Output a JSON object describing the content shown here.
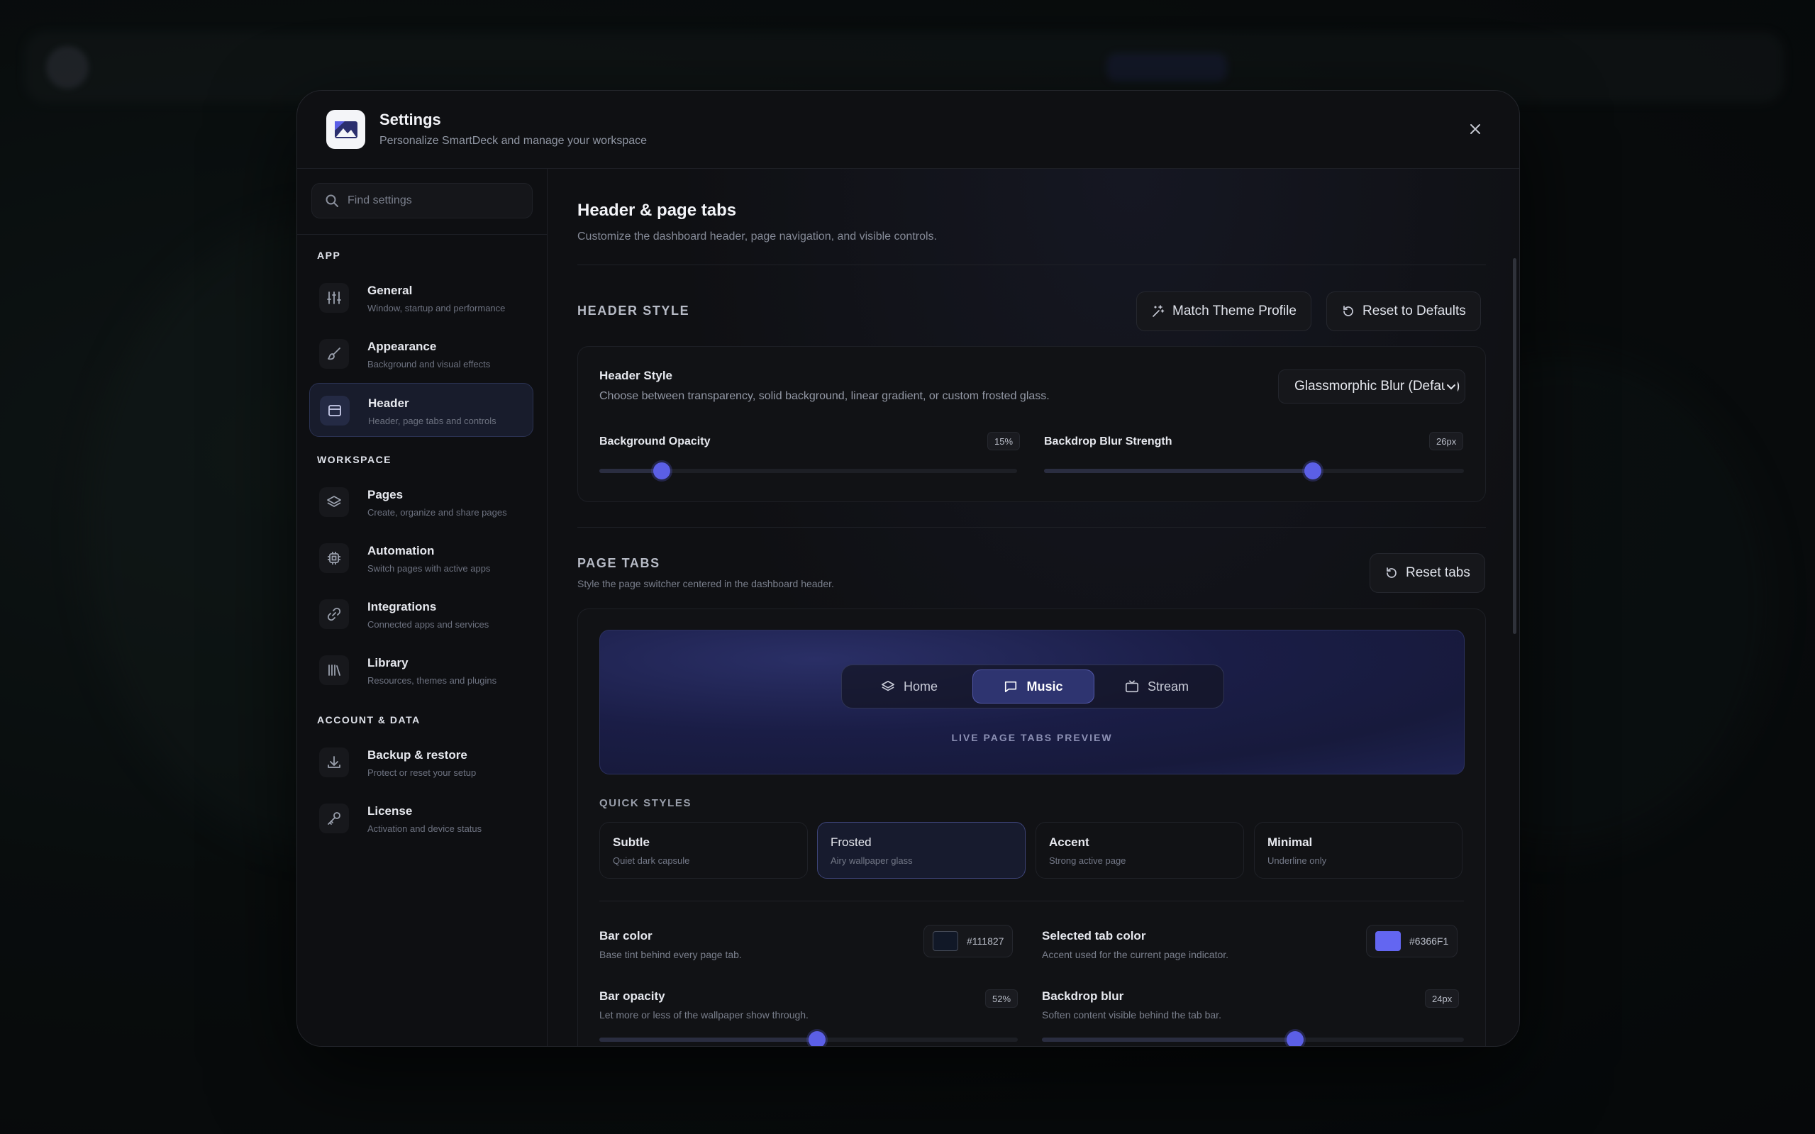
{
  "modal": {
    "title": "Settings",
    "subtitle": "Personalize SmartDeck and manage your workspace"
  },
  "sidebar": {
    "search_placeholder": "Find settings",
    "groups": [
      {
        "label": "APP"
      },
      {
        "label": "WORKSPACE"
      },
      {
        "label": "ACCOUNT & DATA"
      }
    ],
    "items": [
      {
        "label": "General",
        "desc": "Window, startup and performance",
        "icon": "sliders-icon"
      },
      {
        "label": "Appearance",
        "desc": "Background and visual effects",
        "icon": "paintbrush-icon"
      },
      {
        "label": "Header",
        "desc": "Header, page tabs and controls",
        "icon": "window-icon",
        "active": true
      },
      {
        "label": "Pages",
        "desc": "Create, organize and share pages",
        "icon": "layers-icon"
      },
      {
        "label": "Automation",
        "desc": "Switch pages with active apps",
        "icon": "cpu-icon"
      },
      {
        "label": "Integrations",
        "desc": "Connected apps and services",
        "icon": "link-icon"
      },
      {
        "label": "Library",
        "desc": "Resources, themes and plugins",
        "icon": "library-icon"
      },
      {
        "label": "Backup & restore",
        "desc": "Protect or reset your setup",
        "icon": "download-icon"
      },
      {
        "label": "License",
        "desc": "Activation and device status",
        "icon": "key-icon"
      }
    ]
  },
  "main": {
    "title": "Header & page tabs",
    "subtitle": "Customize the dashboard header, page navigation, and visible controls.",
    "header_style": {
      "section_title": "HEADER STYLE",
      "match_theme_label": "Match Theme Profile",
      "reset_defaults_label": "Reset to Defaults",
      "field_label": "Header Style",
      "field_desc": "Choose between transparency, solid background, linear gradient, or custom frosted glass.",
      "select_value": "Glassmorphic Blur (Default)",
      "bg_opacity_label": "Background Opacity",
      "bg_opacity_value": "15%",
      "bg_opacity_fraction": 0.15,
      "blur_label": "Backdrop Blur Strength",
      "blur_value": "26px",
      "blur_fraction": 0.64
    },
    "page_tabs": {
      "section_title": "PAGE TABS",
      "section_desc": "Style the page switcher centered in the dashboard header.",
      "reset_tabs_label": "Reset tabs",
      "preview_tabs": [
        {
          "label": "Home",
          "icon": "layers-icon"
        },
        {
          "label": "Music",
          "icon": "chat-icon",
          "active": true
        },
        {
          "label": "Stream",
          "icon": "tv-icon"
        }
      ],
      "preview_caption": "LIVE PAGE TABS PREVIEW",
      "quick_styles_title": "QUICK STYLES",
      "quick_styles": [
        {
          "name": "Subtle",
          "desc": "Quiet dark capsule"
        },
        {
          "name": "Frosted",
          "desc": "Airy wallpaper glass",
          "active": true
        },
        {
          "name": "Accent",
          "desc": "Strong active page"
        },
        {
          "name": "Minimal",
          "desc": "Underline only"
        }
      ],
      "bar_color_label": "Bar color",
      "bar_color_desc": "Base tint behind every page tab.",
      "bar_color_value": "#111827",
      "selected_color_label": "Selected tab color",
      "selected_color_desc": "Accent used for the current page indicator.",
      "selected_color_value": "#6366F1",
      "bar_opacity_label": "Bar opacity",
      "bar_opacity_desc": "Let more or less of the wallpaper show through.",
      "bar_opacity_value": "52%",
      "bar_opacity_fraction": 0.52,
      "backdrop_blur_label": "Backdrop blur",
      "backdrop_blur_desc": "Soften content visible behind the tab bar.",
      "backdrop_blur_value": "24px",
      "backdrop_blur_fraction": 0.6
    }
  },
  "colors": {
    "accent": "#5b5fe6",
    "modal_bg": "#0f1013",
    "active_nav_bg": "#181c2c"
  }
}
